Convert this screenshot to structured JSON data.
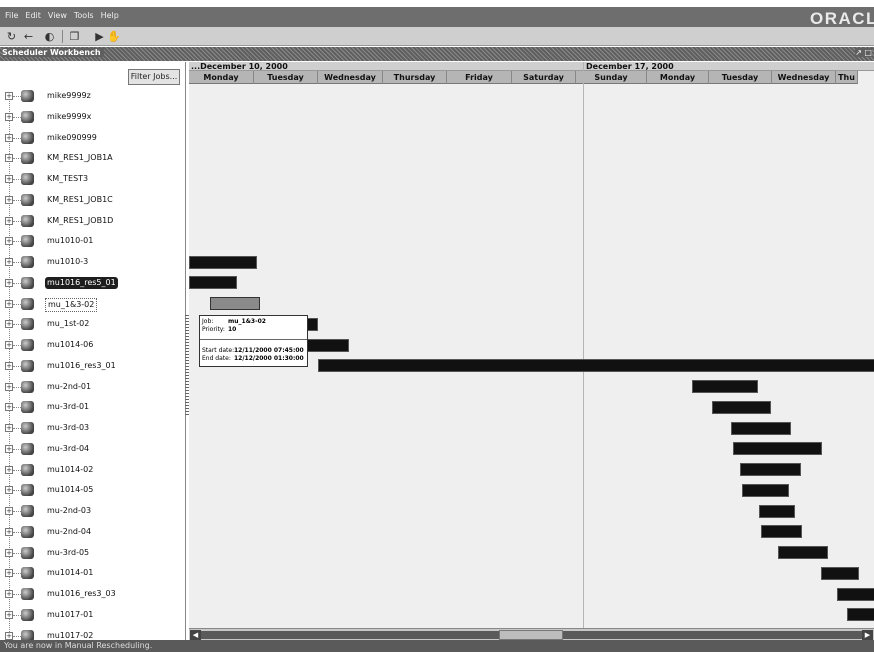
{
  "menubar": {
    "items": [
      "File",
      "Edit",
      "View",
      "Tools",
      "Help"
    ],
    "logo": "ORACLE"
  },
  "toolbar": {
    "icons": [
      "refresh-icon",
      "go-back-icon",
      "compare-icon",
      "copy-icon",
      "run-icon",
      "hand-icon"
    ]
  },
  "window": {
    "title": "Scheduler Workbench",
    "controls": "↗ □"
  },
  "filter": {
    "button_label": "Filter Jobs..."
  },
  "jobs": [
    "mike9999z",
    "mike9999x",
    "mike090999",
    "KM_RES1_JOB1A",
    "KM_TEST3",
    "KM_RES1_JOB1C",
    "KM_RES1_JOB1D",
    "mu1010-01",
    "mu1010-3",
    "mu1016_res5_01",
    "mu_1&3-02",
    "mu_1st-02",
    "mu1014-06",
    "mu1016_res3_01",
    "mu-2nd-01",
    "mu-3rd-01",
    "mu-3rd-03",
    "mu-3rd-04",
    "mu1014-02",
    "mu1014-05",
    "mu-2nd-03",
    "mu-2nd-04",
    "mu-3rd-05",
    "mu1014-01",
    "mu1016_res3_03",
    "mu1017-01",
    "mu1017-02"
  ],
  "selected_job": "mu1016_res5_01",
  "focused_job": "mu_1&3-02",
  "timeline": {
    "weeks": [
      "...December 10, 2000",
      "December 17, 2000"
    ],
    "days": [
      "Monday",
      "Tuesday",
      "Wednesday",
      "Thursday",
      "Friday",
      "Saturday",
      "Sunday",
      "Monday",
      "Tuesday",
      "Wednesday",
      "Thu"
    ]
  },
  "tooltip": {
    "job_label": "Job:",
    "job": "mu_1&3-02",
    "priority_label": "Priority:",
    "priority": "10",
    "start_label": "Start date:",
    "start": "12/11/2000 07:45:00",
    "end_label": "End date:",
    "end": "12/12/2000 01:30:00"
  },
  "status": "You are now in Manual Rescheduling."
}
